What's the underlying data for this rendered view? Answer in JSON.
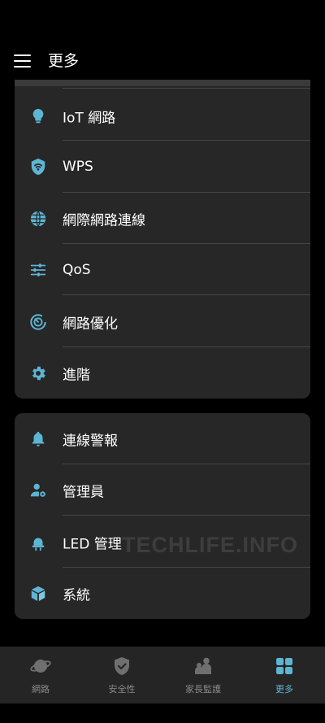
{
  "header": {
    "title": "更多"
  },
  "card1": {
    "items": [
      {
        "label": "IoT 網路",
        "icon": "lightbulb-icon"
      },
      {
        "label": "WPS",
        "icon": "wps-shield-icon"
      },
      {
        "label": "網際網路連線",
        "icon": "globe-icon"
      },
      {
        "label": "QoS",
        "icon": "sliders-icon"
      },
      {
        "label": "網路優化",
        "icon": "optimize-icon"
      },
      {
        "label": "進階",
        "icon": "gear-icon"
      }
    ]
  },
  "card2": {
    "items": [
      {
        "label": "連線警報",
        "icon": "bell-icon"
      },
      {
        "label": "管理員",
        "icon": "admin-user-icon"
      },
      {
        "label": "LED 管理",
        "icon": "led-icon"
      },
      {
        "label": "系統",
        "icon": "box-icon"
      }
    ]
  },
  "watermark": "TECHLIFE.INFO",
  "bottom_nav": {
    "items": [
      {
        "label": "網路",
        "icon": "planet-icon",
        "active": false
      },
      {
        "label": "安全性",
        "icon": "shield-check-icon",
        "active": false
      },
      {
        "label": "家長監護",
        "icon": "family-icon",
        "active": false
      },
      {
        "label": "更多",
        "icon": "grid-icon",
        "active": true
      }
    ]
  },
  "colors": {
    "accent": "#5db5d4",
    "card_bg": "#272727",
    "nav_bg": "#252525",
    "background": "#000000"
  }
}
